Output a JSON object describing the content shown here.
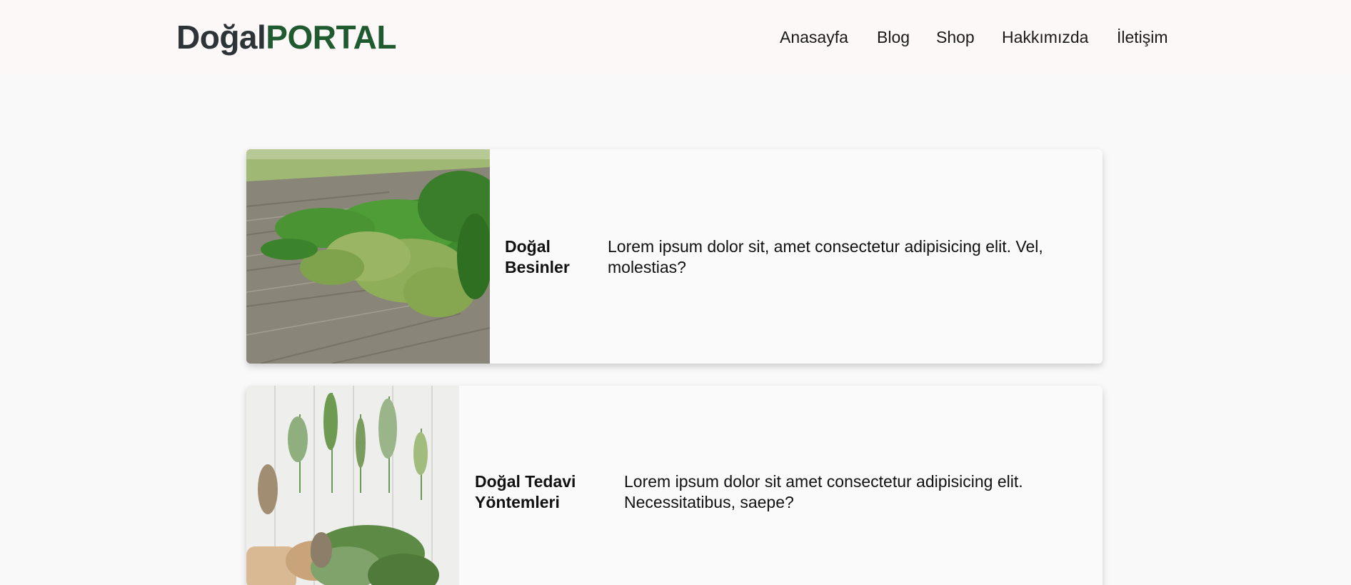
{
  "header": {
    "logo_part1": "Doğal",
    "logo_part2": "PORTAL",
    "nav": [
      "Anasayfa",
      "Blog",
      "Shop",
      "Hakkımızda",
      "İletişim"
    ]
  },
  "cards": [
    {
      "title": "Doğal Besinler",
      "text": "Lorem ipsum dolor sit, amet consectetur adipisicing elit. Vel, molestias?",
      "image_icon": "herb-bunch-on-wood-image"
    },
    {
      "title": "Doğal Tedavi Yöntemleri",
      "text": "Lorem ipsum dolor sit amet consectetur adipisicing elit. Necessitatibus, saepe?",
      "image_icon": "herbs-on-white-wood-image"
    }
  ],
  "colors": {
    "logo_dark": "#2c3438",
    "logo_green": "#1f5b2f",
    "header_bg": "#fdf8f8",
    "page_bg": "#f9f9f9"
  }
}
